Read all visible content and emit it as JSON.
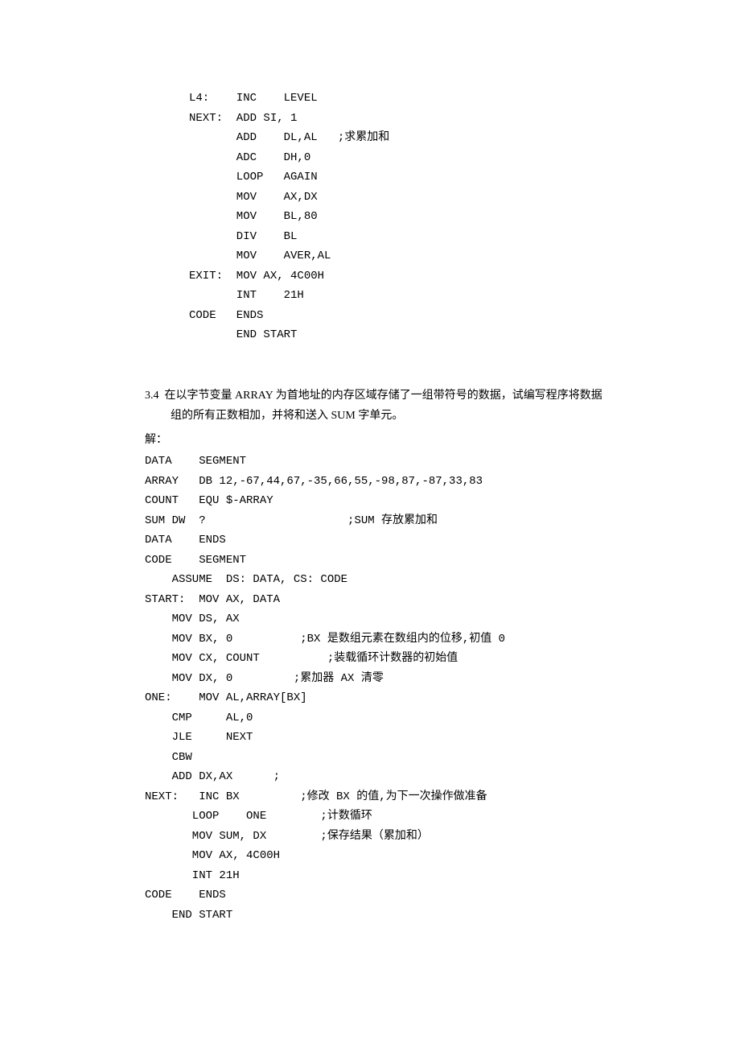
{
  "code1": "L4:    INC    LEVEL\nNEXT:  ADD SI, 1\n       ADD    DL,AL   ;求累加和\n       ADC    DH,0\n       LOOP   AGAIN\n       MOV    AX,DX\n       MOV    BL,80\n       DIV    BL\n       MOV    AVER,AL\nEXIT:  MOV AX, 4C00H\n       INT    21H\nCODE   ENDS\n       END START",
  "question": {
    "number": "3.4",
    "text": "在以字节变量 ARRAY 为首地址的内存区域存储了一组带符号的数据，试编写程序将数据组的所有正数相加，并将和送入 SUM 字单元。"
  },
  "answer_label": "解：",
  "code2": "DATA    SEGMENT\nARRAY   DB 12,-67,44,67,-35,66,55,-98,87,-87,33,83\nCOUNT   EQU $-ARRAY\nSUM DW  ?                     ;SUM 存放累加和\nDATA    ENDS\nCODE    SEGMENT\n    ASSUME  DS: DATA, CS: CODE\nSTART:  MOV AX, DATA\n    MOV DS, AX\n    MOV BX, 0          ;BX 是数组元素在数组内的位移,初值 0\n    MOV CX, COUNT          ;装载循环计数器的初始值\n    MOV DX, 0         ;累加器 AX 清零\nONE:    MOV AL,ARRAY[BX]\n    CMP     AL,0\n    JLE     NEXT\n    CBW\n    ADD DX,AX      ;\nNEXT:   INC BX         ;修改 BX 的值,为下一次操作做准备\n       LOOP    ONE        ;计数循环\n       MOV SUM, DX        ;保存结果（累加和）\n       MOV AX, 4C00H\n       INT 21H\nCODE    ENDS\n    END START"
}
